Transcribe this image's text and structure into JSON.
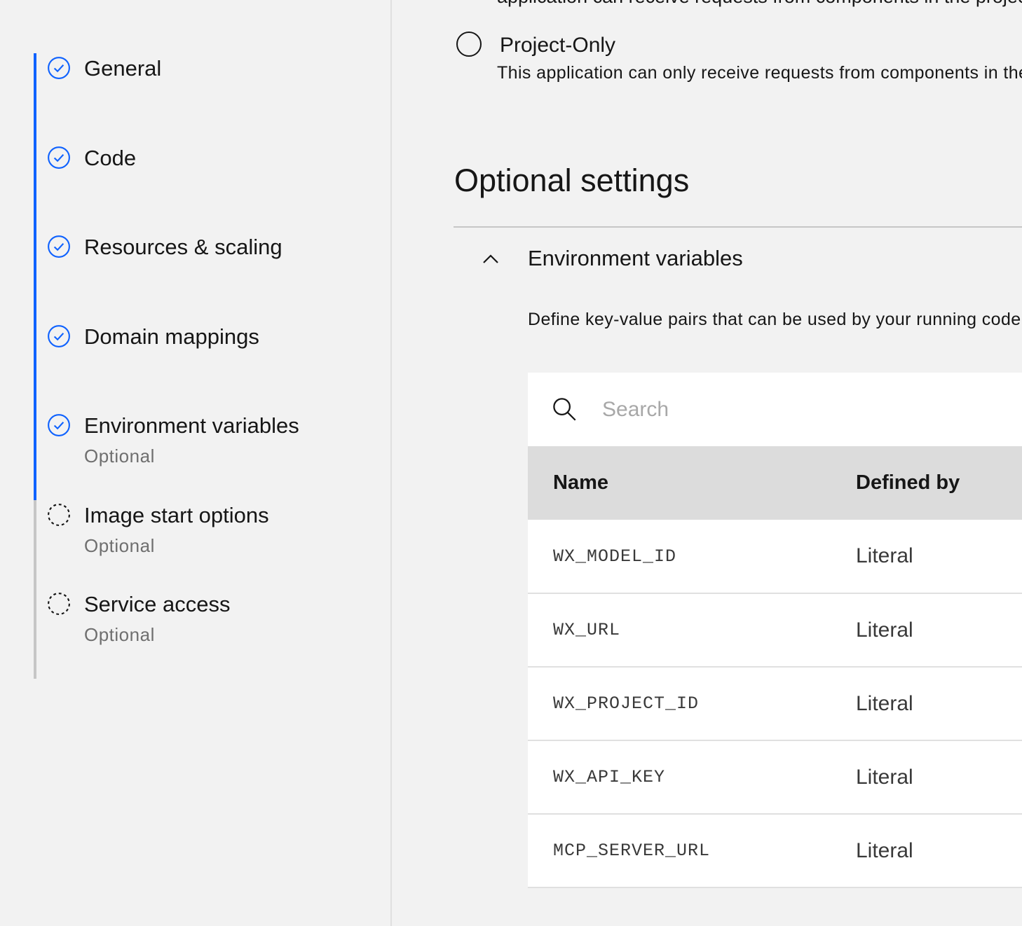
{
  "sidebar": {
    "steps": [
      {
        "label": "General",
        "sublabel": "",
        "status": "complete",
        "icon": "checkmark-outline-icon"
      },
      {
        "label": "Code",
        "sublabel": "",
        "status": "complete",
        "icon": "checkmark-outline-icon"
      },
      {
        "label": "Resources & scaling",
        "sublabel": "",
        "status": "complete",
        "icon": "checkmark-outline-icon"
      },
      {
        "label": "Domain mappings",
        "sublabel": "",
        "status": "complete",
        "icon": "checkmark-outline-icon"
      },
      {
        "label": "Environment variables",
        "sublabel": "Optional",
        "status": "complete",
        "icon": "checkmark-outline-icon"
      },
      {
        "label": "Image start options",
        "sublabel": "Optional",
        "status": "incomplete",
        "icon": "dashed-circle-icon"
      },
      {
        "label": "Service access",
        "sublabel": "Optional",
        "status": "incomplete",
        "icon": "dashed-circle-icon"
      }
    ],
    "colors": {
      "complete": "#0f62fe",
      "incomplete": "#c6c6c6"
    }
  },
  "visibility": {
    "clipped_text": "application can receive requests from components in the project",
    "project_only": {
      "label": "Project-Only",
      "help": "This application can only receive requests from components in the project",
      "selected": false
    }
  },
  "optional_settings": {
    "title": "Optional settings",
    "env_accordion": {
      "title": "Environment variables",
      "expanded": true,
      "description": "Define key-value pairs that can be used by your running code."
    }
  },
  "env_table": {
    "search": {
      "placeholder": "Search",
      "value": ""
    },
    "headers": {
      "name": "Name",
      "defined_by": "Defined by"
    },
    "rows": [
      {
        "name": "WX_MODEL_ID",
        "defined_by": "Literal"
      },
      {
        "name": "WX_URL",
        "defined_by": "Literal"
      },
      {
        "name": "WX_PROJECT_ID",
        "defined_by": "Literal"
      },
      {
        "name": "WX_API_KEY",
        "defined_by": "Literal"
      },
      {
        "name": "MCP_SERVER_URL",
        "defined_by": "Literal"
      }
    ]
  }
}
